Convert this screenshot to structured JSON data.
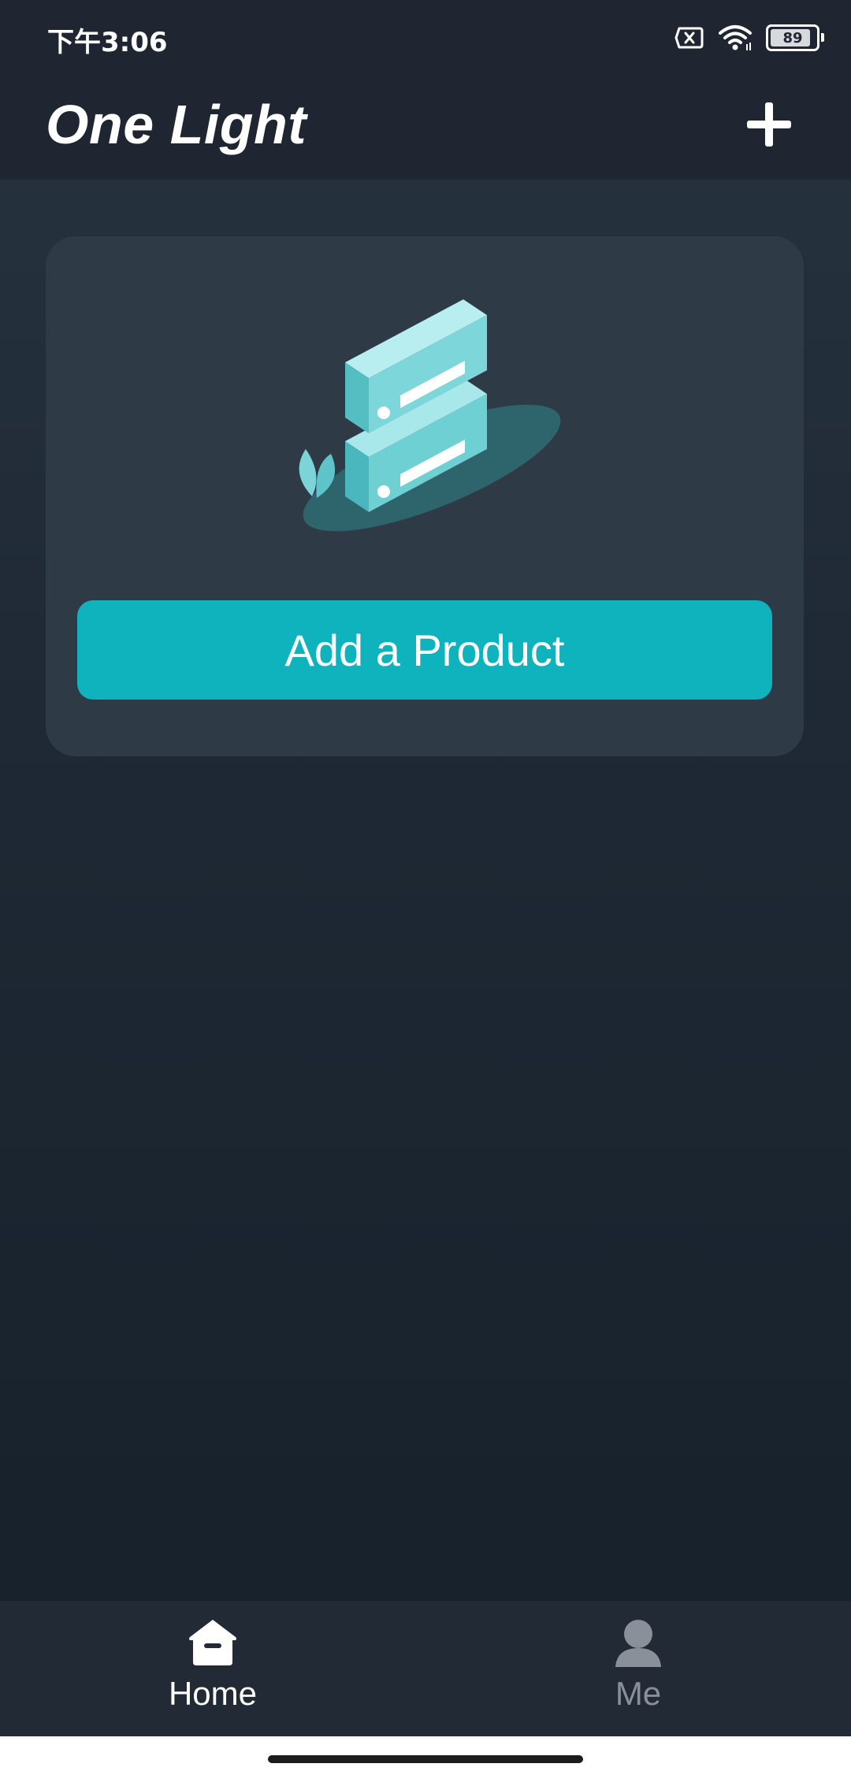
{
  "status_bar": {
    "time": "下午3:06",
    "battery_level": 89,
    "battery_text": "89",
    "icons": [
      "sim-error-icon",
      "wifi-icon",
      "battery-icon"
    ]
  },
  "header": {
    "title": "One Light",
    "add_icon": "plus-icon"
  },
  "card": {
    "illustration": "device-stack-illustration",
    "button_label": "Add a Product",
    "accent_color": "#0fb3bd"
  },
  "tabs": [
    {
      "label": "Home",
      "icon": "home-icon",
      "active": true
    },
    {
      "label": "Me",
      "icon": "user-icon",
      "active": false
    }
  ],
  "colors": {
    "background_top": "#263440",
    "background_bottom": "#16202a",
    "card": "#2f3a47",
    "bar": "#1f2531",
    "inactive_tab": "#8a9099"
  }
}
